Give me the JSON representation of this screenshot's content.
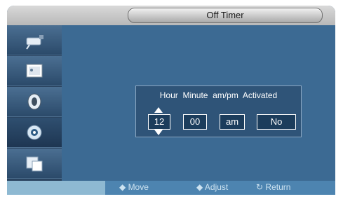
{
  "title": "Off Timer",
  "labels": {
    "hour": "Hour",
    "minute": "Minute",
    "ampm": "am/pm",
    "activated": "Activated"
  },
  "values": {
    "hour": "12",
    "minute": "00",
    "ampm": "am",
    "activated": "No"
  },
  "hints": {
    "move": "Move",
    "adjust": "Adjust",
    "return": "Return"
  },
  "sidebar": {
    "items": [
      "input-icon",
      "picture-icon",
      "sound-icon",
      "setup-icon",
      "multi-icon"
    ],
    "active": 3
  },
  "colors": {
    "background": "#3c6a93",
    "sidebar": "#2a4460",
    "accent": "#8eb9d2"
  }
}
